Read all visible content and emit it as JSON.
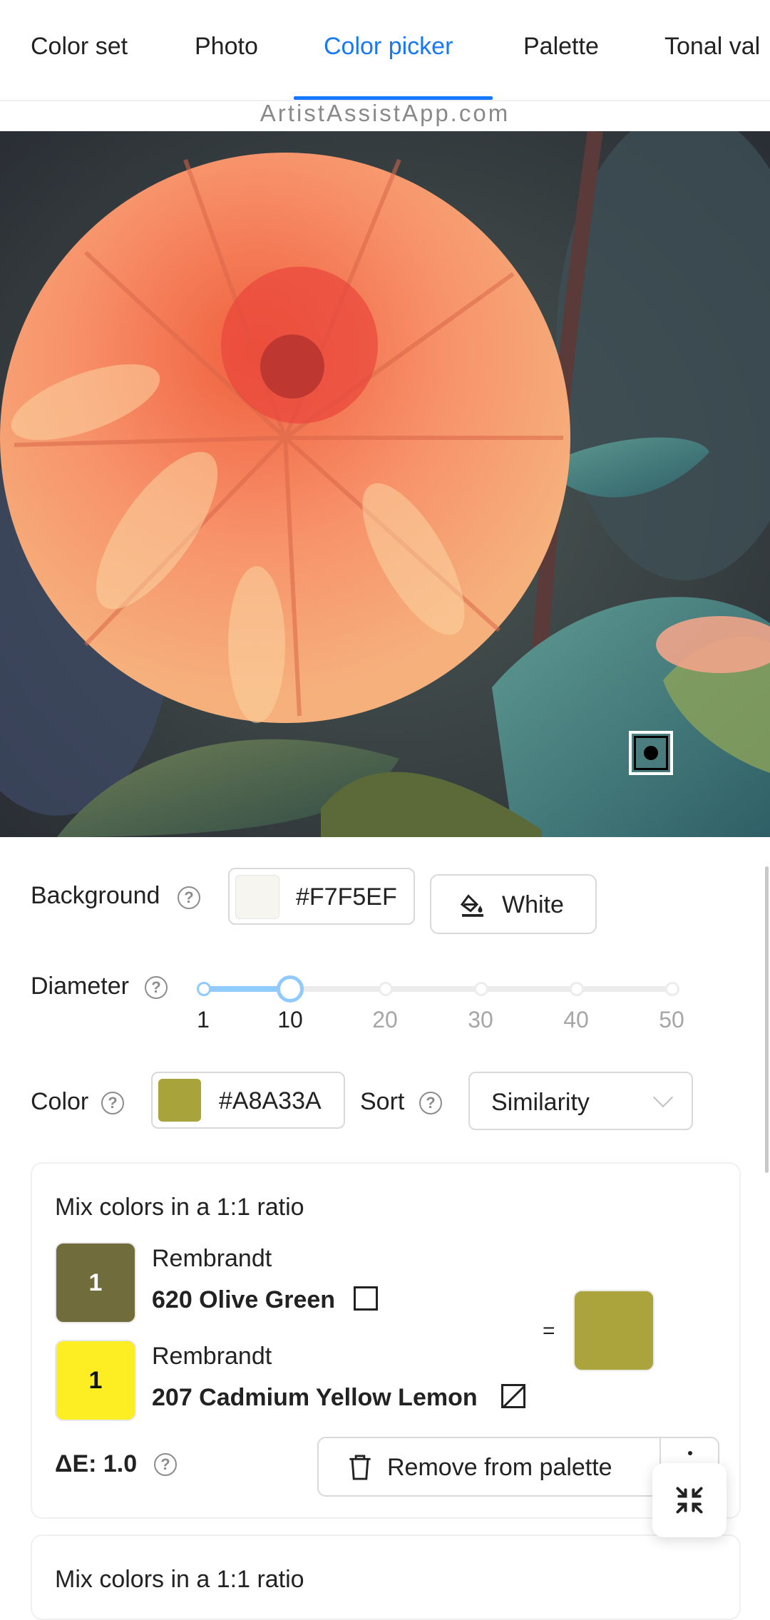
{
  "tabs": [
    {
      "label": "Color set"
    },
    {
      "label": "Photo"
    },
    {
      "label": "Color picker"
    },
    {
      "label": "Palette"
    },
    {
      "label": "Tonal val"
    }
  ],
  "active_tab": "Color picker",
  "watermark": "ArtistAssistApp.com",
  "photo": {
    "description_icon": "dahlia-photo"
  },
  "background": {
    "label": "Background",
    "hex": "#F7F5EF",
    "button_label": "White",
    "button_icon": "paint-bucket-icon"
  },
  "diameter": {
    "label": "Diameter",
    "value": 10,
    "marks": [
      "1",
      "10",
      "20",
      "30",
      "40",
      "50"
    ]
  },
  "color": {
    "label": "Color",
    "hex": "#A8A33A"
  },
  "sort": {
    "label": "Sort",
    "value": "Similarity"
  },
  "mix": {
    "title": "Mix colors in a 1:1 ratio",
    "paints": [
      {
        "parts": "1",
        "brand": "Rembrandt",
        "name": "620 Olive Green",
        "color": "#716c3b"
      },
      {
        "parts": "1",
        "brand": "Rembrandt",
        "name": "207 Cadmium Yellow Lemon",
        "color": "#fcee22"
      }
    ],
    "equals": "=",
    "result_color": "#aba33b",
    "delta_e": "ΔE: 1.0",
    "remove_label": "Remove from palette"
  },
  "next_card_title": "Mix colors in a 1:1 ratio",
  "colors": {
    "accent": "#1677ff",
    "slider": "#91caff",
    "background_swatch": "#F7F5EF",
    "color_swatch": "#A8A33A"
  }
}
